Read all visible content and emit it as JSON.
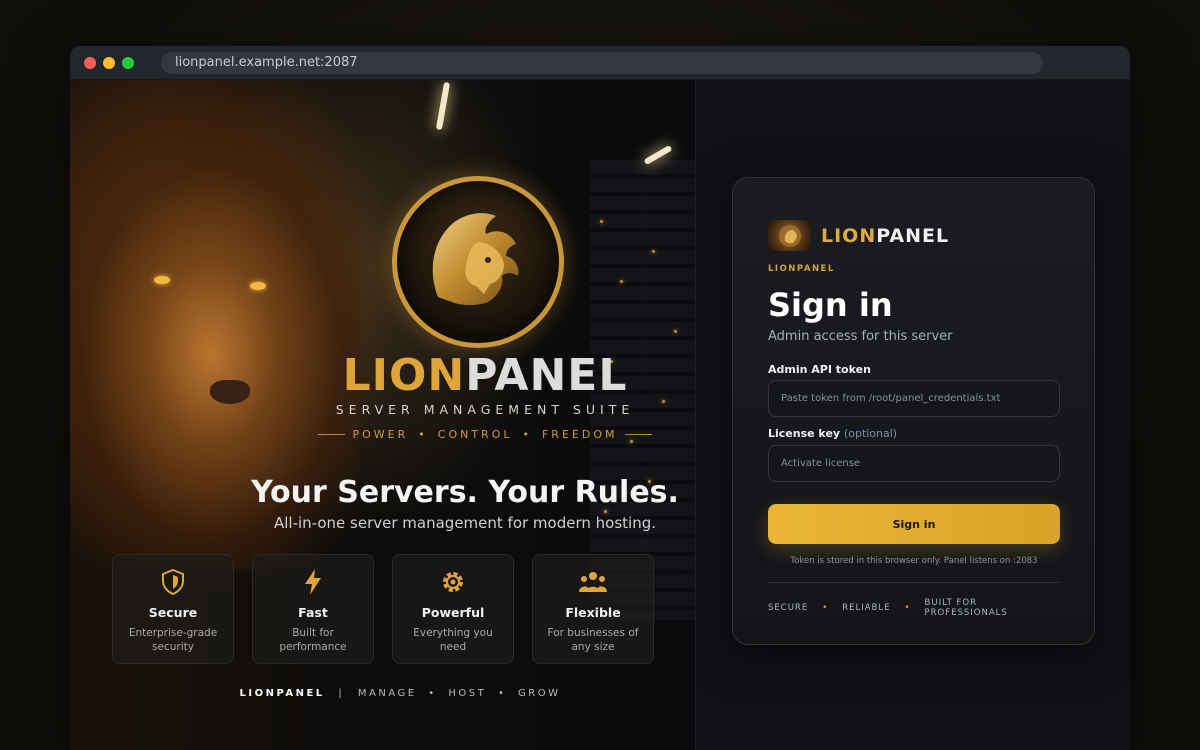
{
  "browser": {
    "url": "lionpanel.example.net:2087"
  },
  "hero": {
    "brand_lion": "LION",
    "brand_panel": "PANEL",
    "suite": "SERVER MANAGEMENT SUITE",
    "tagline": [
      "POWER",
      "CONTROL",
      "FREEDOM"
    ],
    "tagline_sep": "•",
    "title": "Your Servers. Your Rules.",
    "subtitle": "All-in-one server management for modern hosting.",
    "features": [
      {
        "name": "Secure",
        "desc": "Enterprise-grade security",
        "icon": "shield-icon"
      },
      {
        "name": "Fast",
        "desc": "Built for performance",
        "icon": "lightning-icon"
      },
      {
        "name": "Powerful",
        "desc": "Everything you need",
        "icon": "gear-icon"
      },
      {
        "name": "Flexible",
        "desc": "For businesses of any size",
        "icon": "users-icon"
      }
    ],
    "footer_brand": "LIONPANEL",
    "footer_divider": "|",
    "footer_items": [
      "MANAGE",
      "HOST",
      "GROW"
    ],
    "footer_sep": "•"
  },
  "login": {
    "logo_lion": "LION",
    "logo_panel": "PANEL",
    "small_brand": "LIONPANEL",
    "title": "Sign in",
    "subtitle": "Admin access for this server",
    "token_label": "Admin API token",
    "token_placeholder": "Paste token from /root/panel_credentials.txt",
    "license_label": "License key",
    "license_optional": "(optional)",
    "license_placeholder": "Activate license",
    "submit_label": "Sign in",
    "note": "Token is stored in this browser only. Panel listens on :2083",
    "badges": [
      "SECURE",
      "RELIABLE",
      "BUILT FOR PROFESSIONALS"
    ],
    "badge_sep": "•"
  },
  "colors": {
    "accent_gold": "#e3ac38",
    "card_bg": "#1a1c21",
    "page_bg": "#0f1115"
  }
}
